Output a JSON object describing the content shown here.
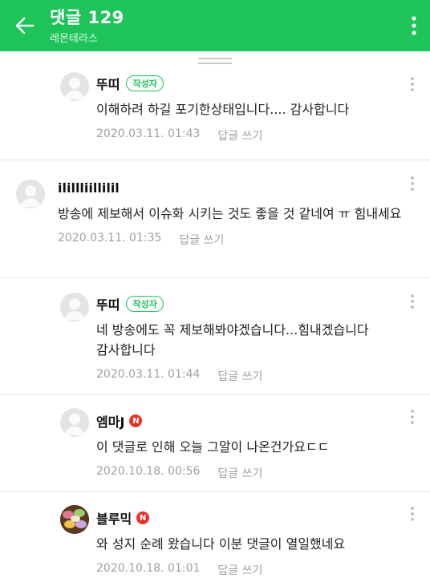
{
  "header": {
    "title": "댓글 129",
    "subtitle": "레몬테라스",
    "icons": {
      "back": "arrow-left-icon",
      "menu": "more-vertical-icon"
    },
    "color": "#1ec35a"
  },
  "reply_label": "답글 쓰기",
  "author_badge": "작성자",
  "n_badge": "N",
  "comments": [
    {
      "name": "뚜띠",
      "text": "이해하려 하길 포기한상태입니다.... 감사합니다",
      "date": "2020.03.11. 01:43"
    },
    {
      "name": "ilillliillilil",
      "text": "방송에 제보해서 이슈화 시키는 것도 좋을 것 같네여 ㅠ 힘내세요",
      "date": "2020.03.11. 01:35"
    },
    {
      "name": "뚜띠",
      "text": "네 방송에도 꼭 제보해봐야겠습니다...힘내겠습니다 감사합니다",
      "date": "2020.03.11. 01:44"
    },
    {
      "name": "엠마J",
      "text": "이 댓글로 인해 오늘 그알이 나온건가요ㄷㄷ",
      "date": "2020.10.18. 00:56"
    },
    {
      "name": "블루믹",
      "text": "와 성지 순례 왔습니다 이분 댓글이 열일했네요",
      "date": "2020.10.18. 01:01"
    }
  ],
  "colors": {
    "accent": "#1ec35a",
    "new_badge": "#e8322a",
    "meta_text": "#a0a0a0"
  }
}
